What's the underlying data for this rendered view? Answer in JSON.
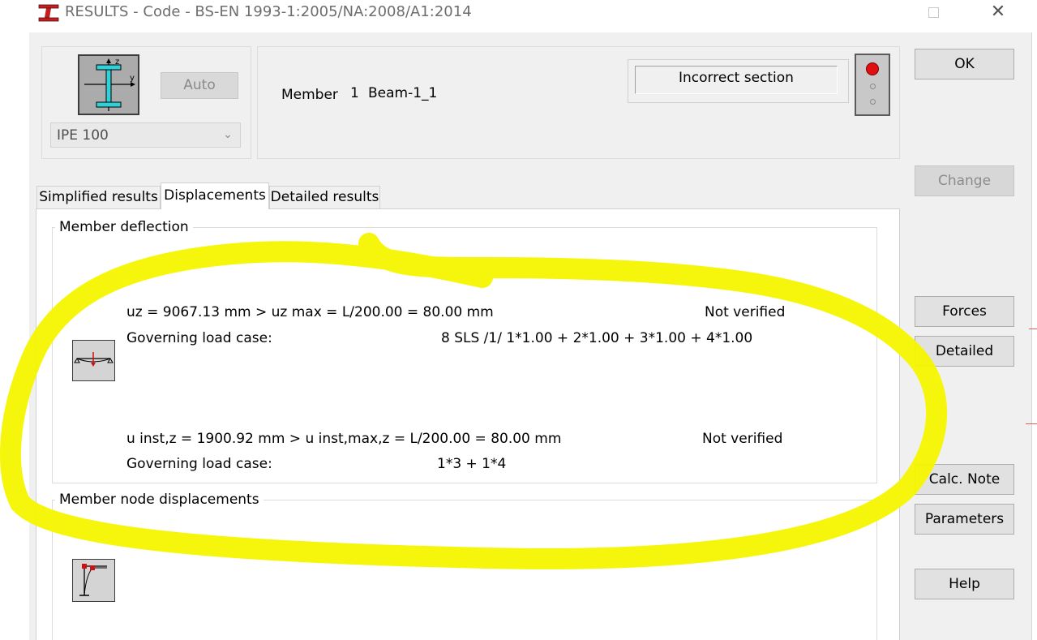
{
  "window": {
    "title": "RESULTS - Code - BS-EN 1993-1:2005/NA:2008/A1:2014",
    "close_glyph": "✕"
  },
  "section": {
    "auto_label": "Auto",
    "selected": "IPE 100",
    "axis_z": "z",
    "axis_y": "y"
  },
  "member": {
    "label": "Member",
    "number": "1",
    "name": "Beam-1_1"
  },
  "status": {
    "message": "Incorrect section",
    "indicator_color": "#e11010"
  },
  "buttons": {
    "ok": "OK",
    "change": "Change",
    "forces": "Forces",
    "detailed": "Detailed",
    "calc_note": "Calc. Note",
    "parameters": "Parameters",
    "help": "Help"
  },
  "tabs": [
    {
      "label": "Simplified results",
      "active": false
    },
    {
      "label": "Displacements",
      "active": true
    },
    {
      "label": "Detailed results",
      "active": false
    }
  ],
  "deflection": {
    "caption": "Member deflection",
    "uz_line": "uz = 9067.13 mm  >  uz max = L/200.00 = 80.00 mm",
    "uz_status": "Not verified",
    "uz_case_label": "Governing load case:",
    "uz_case_value": "8 SLS /1/  1*1.00 + 2*1.00 + 3*1.00 + 4*1.00",
    "uinst_line": "u inst,z = 1900.92 mm  >  u inst,max,z = L/200.00 = 80.00 mm",
    "uinst_status": "Not verified",
    "uinst_case_label": "Governing load case:",
    "uinst_case_value": "1*3 + 1*4"
  },
  "nodes": {
    "caption": "Member node displacements"
  },
  "colors": {
    "highlight": "#f5f500",
    "profile": "#2fd0d8",
    "dialog_bg": "#f0f0f0"
  }
}
